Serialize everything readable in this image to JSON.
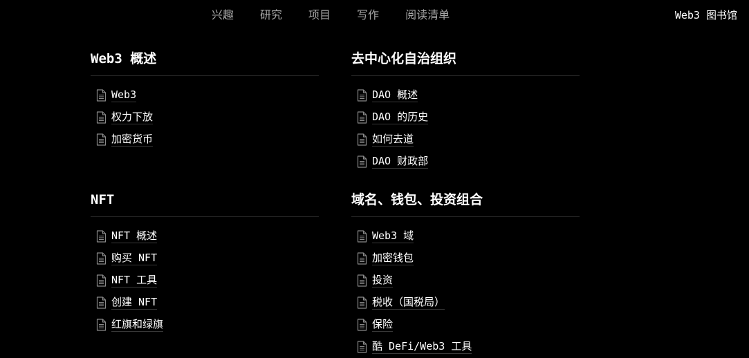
{
  "nav": {
    "links": [
      "兴趣",
      "研究",
      "项目",
      "写作",
      "阅读清单"
    ],
    "brand": "Web3 图书馆"
  },
  "colors": {
    "background": "#000000",
    "nav_text": "#a6a6a6",
    "text": "#ffffff",
    "rule": "#262626",
    "icon": "#8a8a8a"
  },
  "icons": {
    "item": "document-icon"
  },
  "sections": [
    {
      "title": "Web3 概述",
      "items": [
        "Web3",
        "权力下放",
        "加密货币"
      ]
    },
    {
      "title": "去中心化自治组织",
      "items": [
        "DAO 概述",
        "DAO 的历史",
        "如何去道",
        "DAO 财政部"
      ]
    },
    {
      "title": "NFT",
      "items": [
        "NFT 概述",
        "购买 NFT",
        "NFT 工具",
        "创建 NFT",
        "红旗和绿旗"
      ]
    },
    {
      "title": "域名、钱包、投资组合",
      "items": [
        "Web3 域",
        "加密钱包",
        "投资",
        "税收（国税局）",
        "保险",
        "酷 DeFi/Web3 工具"
      ]
    }
  ]
}
